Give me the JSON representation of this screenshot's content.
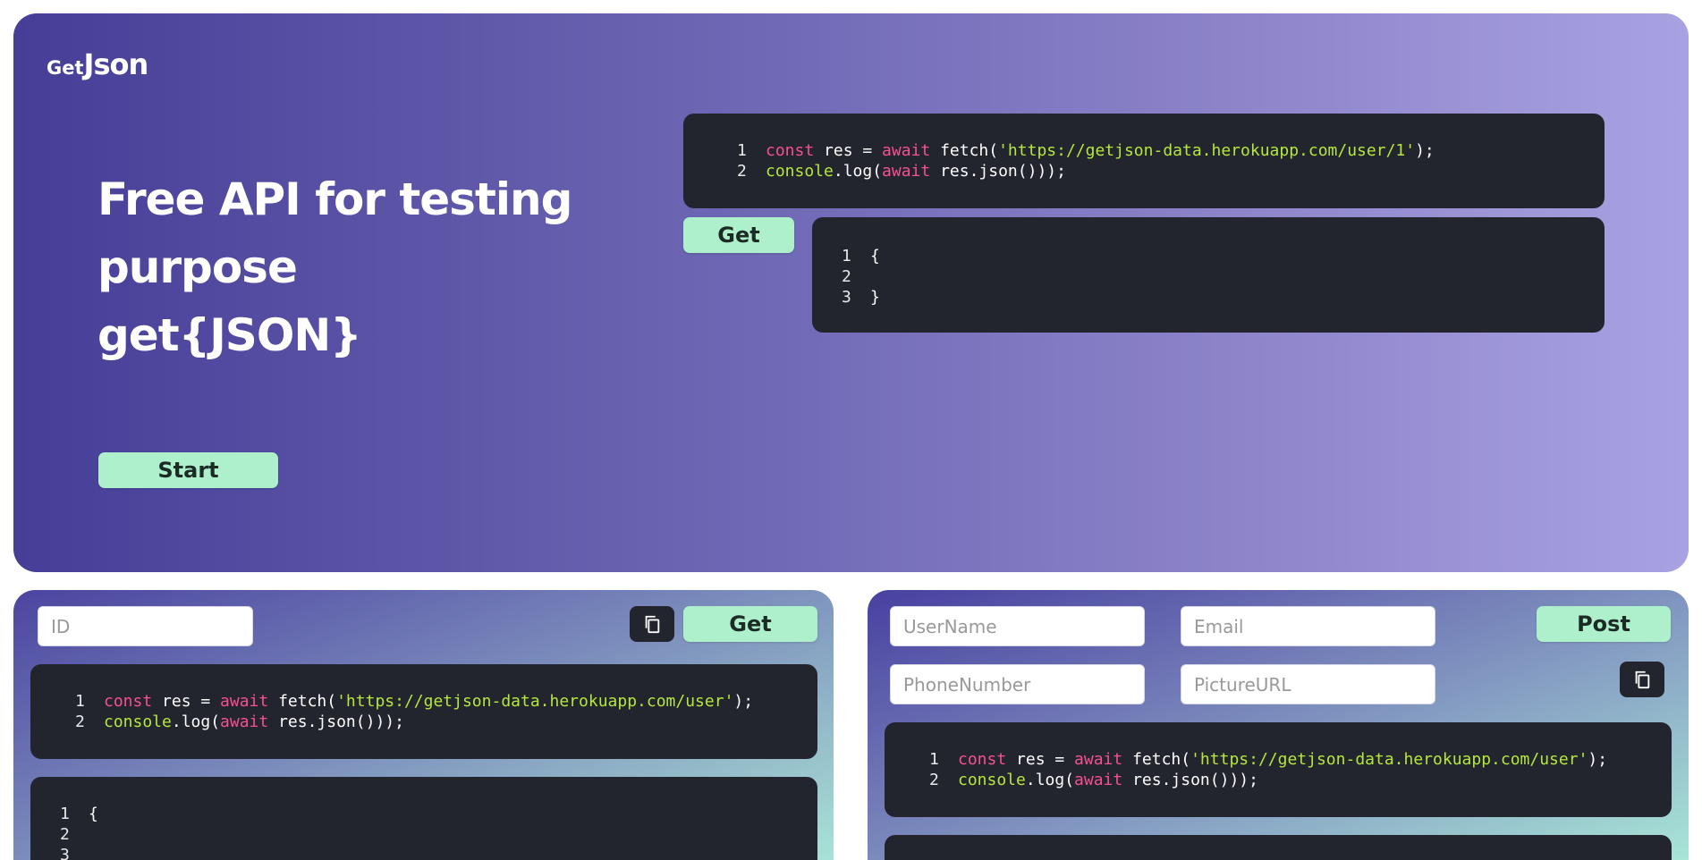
{
  "hero": {
    "logo_prefix": "Get",
    "logo_main": "Json",
    "title_lines": [
      "Free API for testing",
      "purpose",
      "get{JSON}"
    ],
    "start_label": "Start",
    "get_label": "Get",
    "request_code": {
      "line1": {
        "n": "1",
        "kw1": "const",
        "t1": " res = ",
        "kw2": "await",
        "t2": " fetch(",
        "str": "'https://getjson-data.herokuapp.com/user/1'",
        "t3": ");"
      },
      "line2": {
        "n": "2",
        "fn": "console",
        "t1": ".log(",
        "kw": "await",
        "t2": " res.json()));"
      }
    },
    "response_code": [
      {
        "n": "1",
        "text": "{"
      },
      {
        "n": "2",
        "text": ""
      },
      {
        "n": "3",
        "text": "}"
      }
    ]
  },
  "get_panel": {
    "id_placeholder": "ID",
    "get_label": "Get",
    "copy_icon": "copy-icon",
    "request_code": {
      "line1": {
        "n": "1",
        "kw1": "const",
        "t1": " res = ",
        "kw2": "await",
        "t2": " fetch(",
        "str": "'https://getjson-data.herokuapp.com/user'",
        "t3": ");"
      },
      "line2": {
        "n": "2",
        "fn": "console",
        "t1": ".log(",
        "kw": "await",
        "t2": " res.json()));"
      }
    },
    "response_code": [
      {
        "n": "1",
        "text": "{"
      },
      {
        "n": "2",
        "text": ""
      },
      {
        "n": "3",
        "text": ""
      }
    ]
  },
  "post_panel": {
    "username_placeholder": "UserName",
    "email_placeholder": "Email",
    "phone_placeholder": "PhoneNumber",
    "picture_placeholder": "PictureURL",
    "post_label": "Post",
    "copy_icon": "copy-icon",
    "request_code": {
      "line1": {
        "n": "1",
        "kw1": "const",
        "t1": " res = ",
        "kw2": "await",
        "t2": " fetch(",
        "str": "'https://getjson-data.herokuapp.com/user'",
        "t3": ");"
      },
      "line2": {
        "n": "2",
        "fn": "console",
        "t1": ".log(",
        "kw": "await",
        "t2": " res.json()));"
      }
    }
  },
  "colors": {
    "accent_green": "#aef0cc",
    "code_bg": "#22252e",
    "keyword": "#f7508f",
    "string": "#b5e83b"
  }
}
